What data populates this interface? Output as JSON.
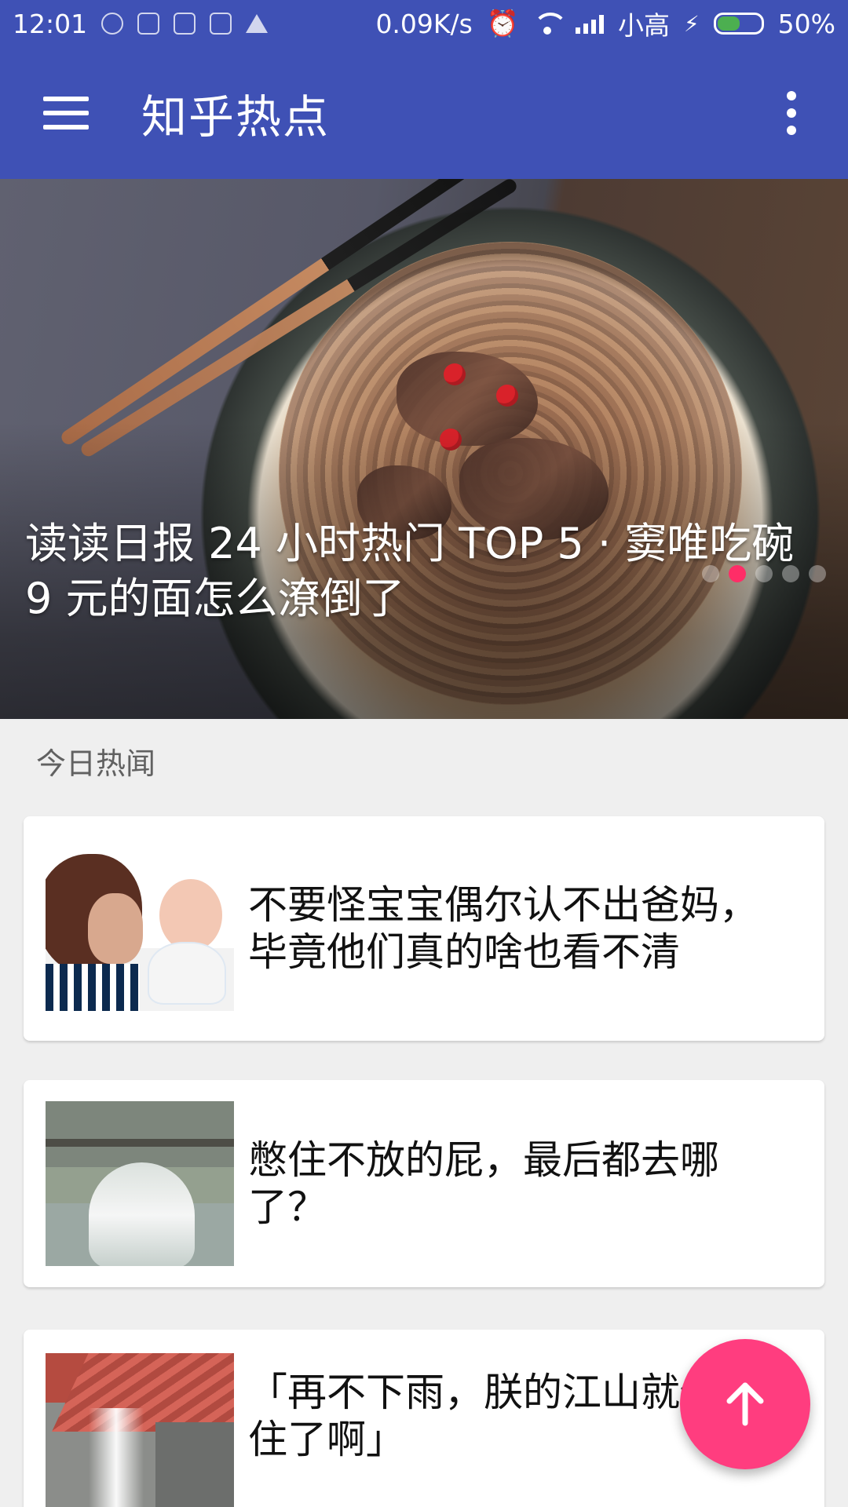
{
  "status_bar": {
    "time": "12:01",
    "network_speed": "0.09K/s",
    "carrier": "小高",
    "battery": "50%",
    "battery_level": 0.5,
    "icons": [
      "settings-icon",
      "window-icon",
      "mail-icon",
      "folder-icon",
      "flask-icon",
      "alarm-icon",
      "wifi-icon",
      "signal-icon",
      "charging-icon",
      "battery-icon"
    ]
  },
  "app_bar": {
    "title": "知乎热点",
    "menu_icon": "menu-icon",
    "more_icon": "more-vert-icon"
  },
  "banner": {
    "caption": "读读日报 24 小时热门 TOP 5 · 窦唯吃碗 9 元的面怎么潦倒了",
    "active_page": 2,
    "page_count": 5,
    "accent_color": "#ff2d67"
  },
  "section": {
    "title": "今日热闻"
  },
  "cards": [
    {
      "title": "不要怪宝宝偶尔认不出爸妈，毕竟他们真的啥也看不清"
    },
    {
      "title": "憋住不放的屁，最后都去哪了？"
    },
    {
      "title": "「再不下雨，朕的江山就保不住了啊」"
    }
  ],
  "fab": {
    "icon": "arrow-up-icon",
    "color": "#ff3d7f"
  },
  "colors": {
    "primary": "#3f51b5",
    "background": "#efefef",
    "card": "#ffffff"
  }
}
